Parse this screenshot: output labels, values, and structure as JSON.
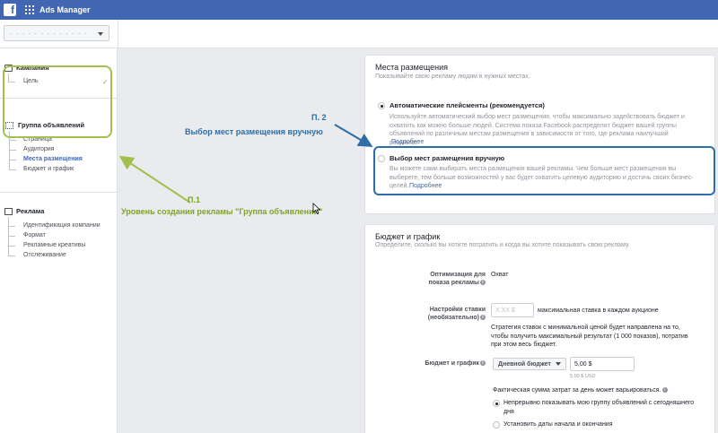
{
  "topbar": {
    "app_title": "Ads Manager",
    "logo": "f"
  },
  "account": {
    "value": "· · · · · · · · · · · · ·"
  },
  "sidebar": {
    "campaign": {
      "title": "Кампания",
      "items": [
        {
          "label": "Цель",
          "check": "✓"
        }
      ]
    },
    "adset": {
      "title": "Группа объявлений",
      "items": [
        {
          "label": "Страница"
        },
        {
          "label": "Аудитория"
        },
        {
          "label": "Места размещения"
        },
        {
          "label": "Бюджет и график"
        }
      ]
    },
    "ad": {
      "title": "Реклама",
      "items": [
        {
          "label": "Идентификация компании"
        },
        {
          "label": "Формат"
        },
        {
          "label": "Рекламные креативы"
        },
        {
          "label": "Отслеживание"
        }
      ]
    }
  },
  "annotations": {
    "p1_label": "П.1",
    "p1_text": "Уровень создания рекламы \"Группа объявлений\"",
    "p2_label": "П. 2",
    "p2_text": "Выбор мест размещения вручную"
  },
  "placements": {
    "title": "Места размещения",
    "subtitle": "Показывайте свою рекламу людям в нужных местах.",
    "auto": {
      "label": "Автоматические плейсменты (рекомендуется)",
      "desc": "Используйте автоматический выбор мест размещения, чтобы максимально задействовать бюджет и охватить как можно больше людей. Система показа Facebook распределит бюджет вашей группы объявлений по различным местам размещения в зависимости от того, где реклама наилучший результат.",
      "link": "Подробнее"
    },
    "manual": {
      "label": "Выбор мест размещения вручную",
      "desc": "Вы можете сами выбирать места размещения вашей рекламы. Чем больше мест размещения вы выберете, тем больше возможностей у вас будет охватить целевую аудиторию и достичь своих бизнес-целей.",
      "link": "Подробнее"
    }
  },
  "budget": {
    "title": "Бюджет и график",
    "subtitle": "Определите, сколько вы хотите потратить и когда вы хотите показывать свою рекламу.",
    "optimization_label": "Оптимизация для показа рекламы",
    "optimization_value": "Охват",
    "bid_label": "Настройки ставки (необязательно)",
    "bid_placeholder": "X.XX $",
    "bid_hint": "максимальная ставка в каждом аукционе",
    "bid_desc": "Стратегия ставок с минимальной ценой будет направлена на то, чтобы получить максимальный результат (1 000 показов), потратив при этом весь бюджет.",
    "budget_label": "Бюджет и график",
    "budget_type": "Дневной бюджет",
    "budget_value": "5,00 $",
    "budget_usd": "5,00 $ USD",
    "spend_note": "Фактическая сумма затрат за день может варьироваться.",
    "schedule_opt1": "Непрерывно показывать мою группу объявлений с сегодняшнего дня",
    "schedule_opt2": "Установить даты начала и окончания"
  },
  "colors": {
    "brand": "#4267b2",
    "annotation_green": "#7ea32a",
    "annotation_blue": "#2d6ea8"
  }
}
